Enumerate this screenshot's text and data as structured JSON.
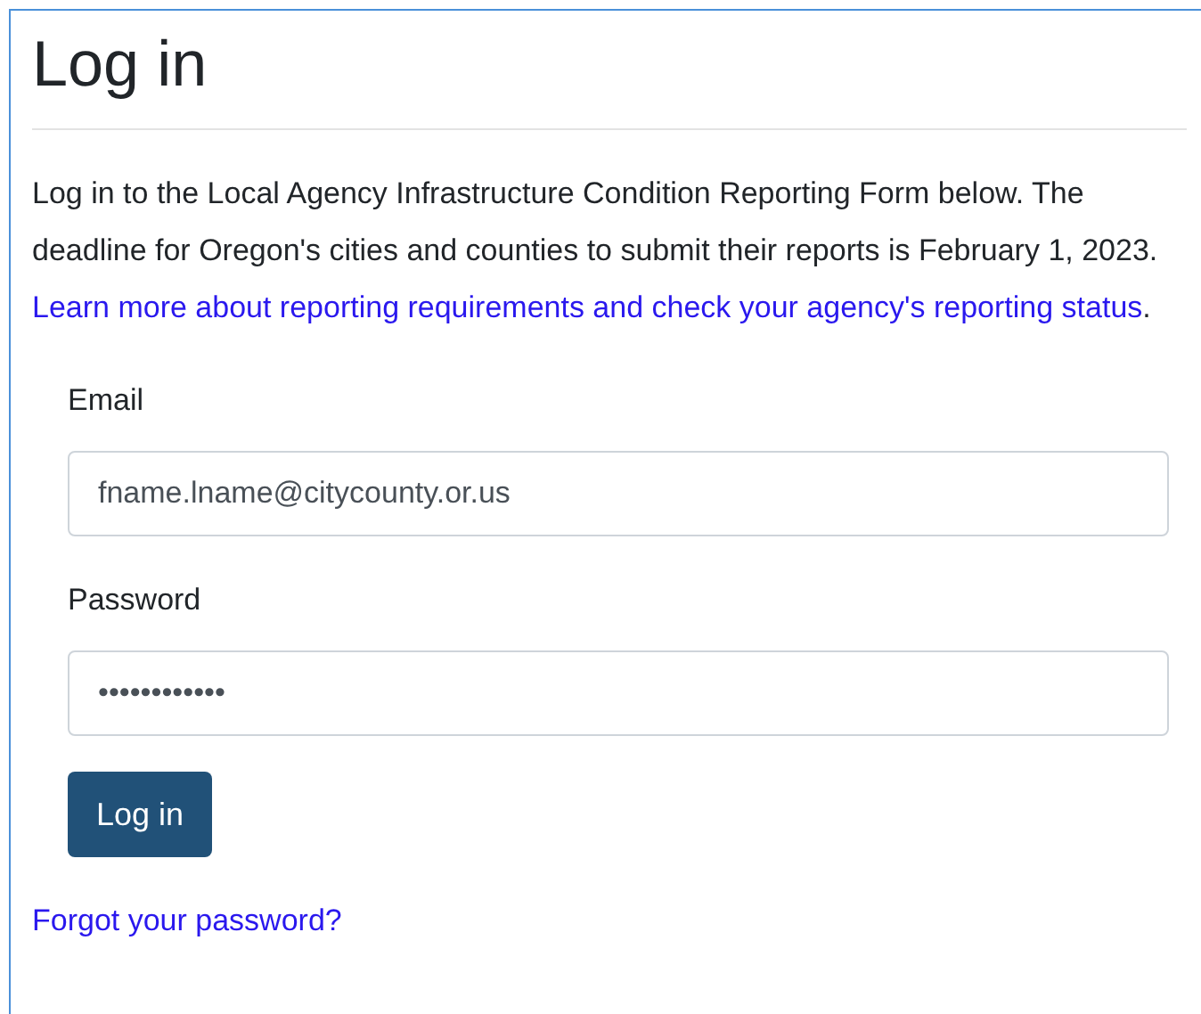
{
  "title": "Log in",
  "intro": {
    "text": "Log in to the Local Agency Infrastructure Condition Reporting Form below. The deadline for Oregon's cities and counties to submit their reports is February 1, 2023.",
    "link": "Learn more about reporting requirements and check your agency's reporting status",
    "end": "."
  },
  "fields": [
    {
      "label": "Email",
      "value": "fname.lname@citycounty.or.us"
    },
    {
      "label": "Password",
      "value": "••••••••••••"
    }
  ],
  "submit": "Log in",
  "forgot_link": "Forgot your password?"
}
